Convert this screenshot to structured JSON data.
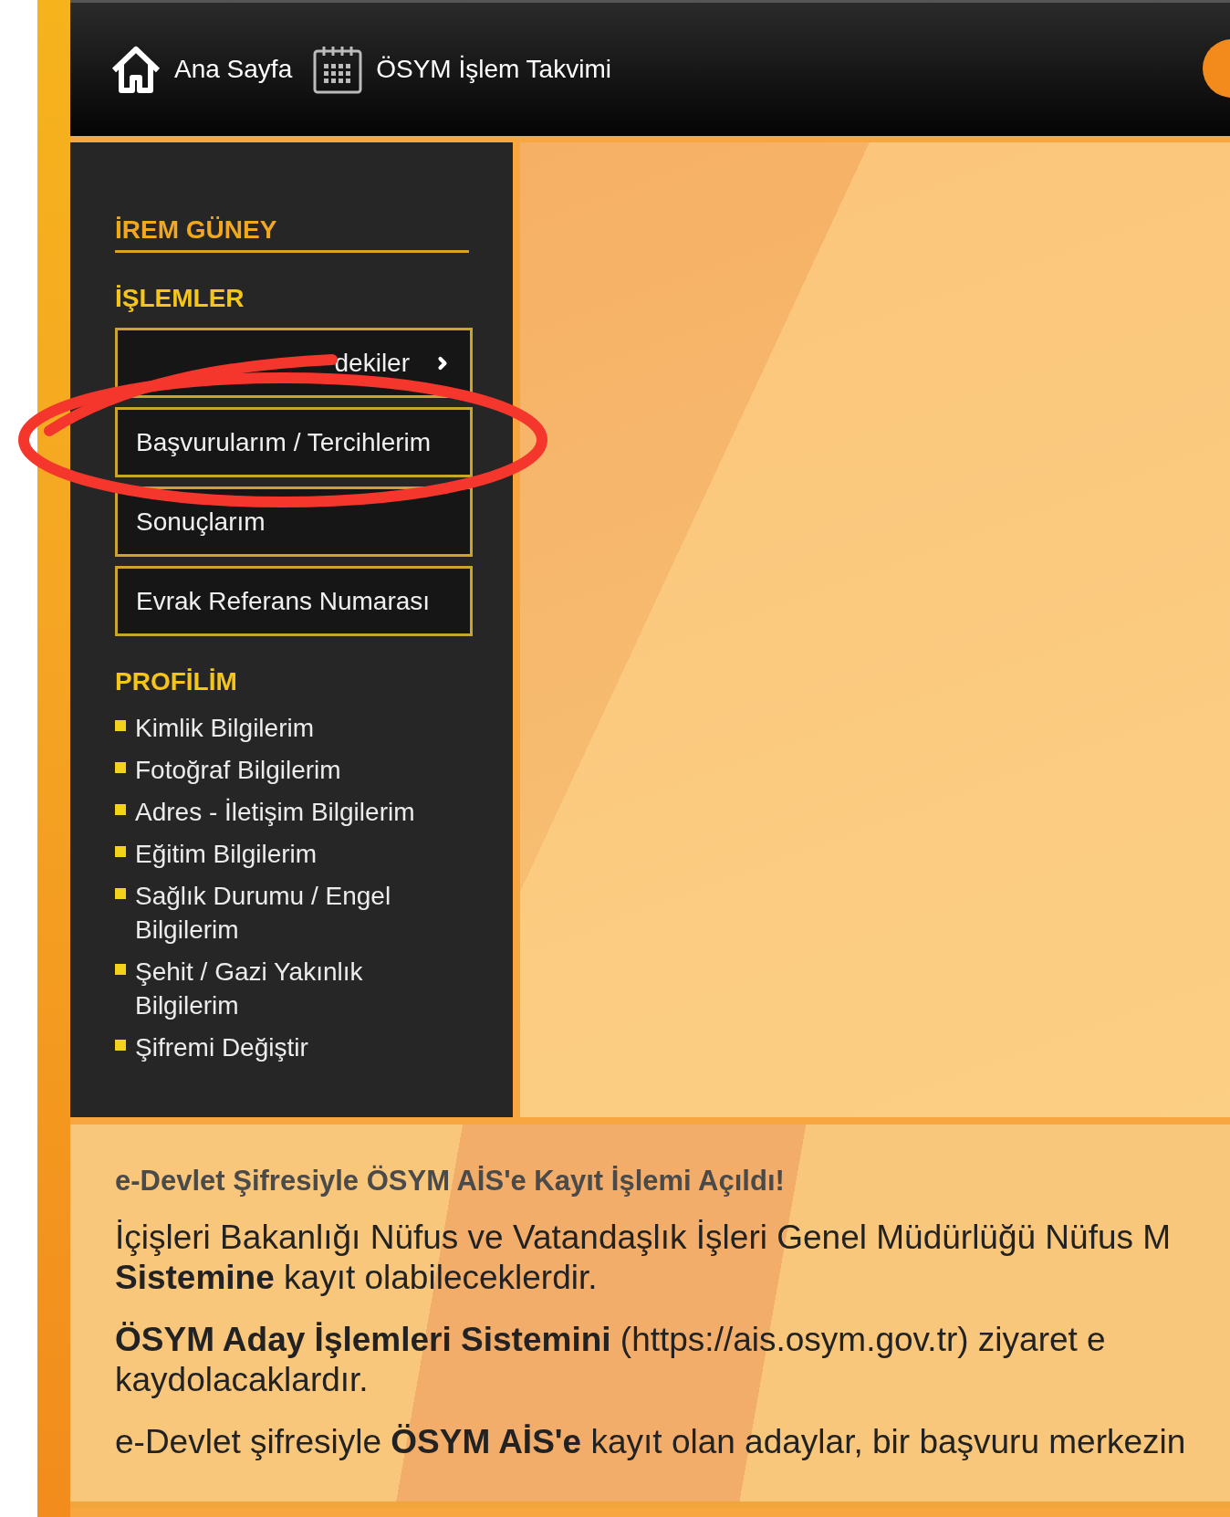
{
  "header": {
    "links": [
      {
        "label": "Ana Sayfa"
      },
      {
        "label": "ÖSYM İşlem Takvimi"
      }
    ]
  },
  "sidebar": {
    "user_name": "İREM GÜNEY",
    "sections": [
      {
        "title": "İŞLEMLER",
        "kind": "buttons",
        "items": [
          {
            "label": "dekiler",
            "has_submenu": true
          },
          {
            "label": "Başvurularım / Tercihlerim",
            "has_submenu": false
          },
          {
            "label": "Sonuçlarım",
            "has_submenu": false
          },
          {
            "label": "Evrak Referans Numarası",
            "has_submenu": false
          }
        ]
      },
      {
        "title": "PROFİLİM",
        "kind": "links",
        "items": [
          {
            "label": "Kimlik Bilgilerim"
          },
          {
            "label": "Fotoğraf Bilgilerim"
          },
          {
            "label": "Adres - İletişim Bilgilerim"
          },
          {
            "label": "Eğitim Bilgilerim"
          },
          {
            "label": "Sağlık Durumu / Engel Bilgilerim"
          },
          {
            "label": "Şehit / Gazi Yakınlık Bilgilerim"
          },
          {
            "label": "Şifremi Değiştir"
          }
        ]
      }
    ]
  },
  "notice": {
    "title": "e-Devlet Şifresiyle ÖSYM AİS'e Kayıt İşlemi Açıldı!",
    "paragraphs": [
      {
        "lines": [
          "İçişleri Bakanlığı Nüfus ve Vatandaşlık İşleri Genel Müdürlüğü Nüfus M",
          "**Sistemine** kayıt olabileceklerdir."
        ]
      },
      {
        "lines": [
          "**ÖSYM Aday İşlemleri Sistemini** (https://ais.osym.gov.tr) ziyaret e",
          "kaydolacaklardır."
        ]
      },
      {
        "lines": [
          "e-Devlet şifresiyle **ÖSYM AİS'e** kayıt olan adaylar, bir başvuru merkezin"
        ]
      }
    ]
  }
}
